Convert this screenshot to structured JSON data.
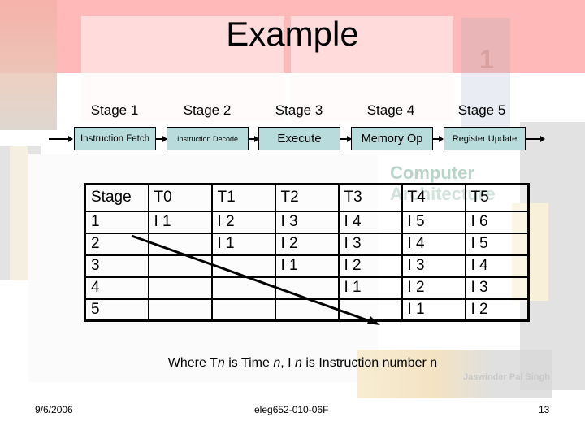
{
  "slide": {
    "title": "Example",
    "pipeline": {
      "stages": [
        {
          "label": "Stage 1",
          "box": "Instruction Fetch"
        },
        {
          "label": "Stage 2",
          "box": "Instruction Decode"
        },
        {
          "label": "Stage 3",
          "box": "Execute"
        },
        {
          "label": "Stage 4",
          "box": "Memory Op"
        },
        {
          "label": "Stage 5",
          "box": "Register Update"
        }
      ],
      "box_color": "#b8dcdc"
    },
    "table": {
      "header": [
        "Stage",
        "T0",
        "T1",
        "T2",
        "T3",
        "T4",
        "T5"
      ],
      "rows": [
        [
          "1",
          "I 1",
          "I 2",
          "I 3",
          "I 4",
          "I 5",
          "I 6"
        ],
        [
          "2",
          "",
          "I 1",
          "I 2",
          "I 3",
          "I 4",
          "I 5"
        ],
        [
          "3",
          "",
          "",
          "I 1",
          "I 2",
          "I 3",
          "I 4"
        ],
        [
          "4",
          "",
          "",
          "",
          "I 1",
          "I 2",
          "I 3"
        ],
        [
          "5",
          "",
          "",
          "",
          "",
          "I 1",
          "I 2"
        ]
      ]
    },
    "caption": {
      "part1": "Where T",
      "n1": "n",
      "part2": " is Time ",
      "n2": "n",
      "part3": ", I ",
      "n3": "n",
      "part4": " is Instruction number n"
    },
    "footer": {
      "date": "9/6/2006",
      "course": "eleg652-010-06F",
      "page": "13"
    },
    "background": {
      "book_title_text": "Computer Architecture",
      "book_author_text": "Jaswinder Pal Singh",
      "book_number": "1"
    }
  }
}
